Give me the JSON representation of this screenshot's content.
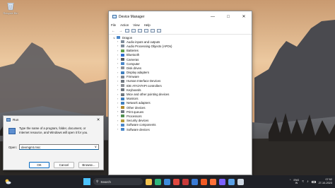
{
  "desktop": {
    "recycle_bin_label": "Recycle Bin"
  },
  "device_manager": {
    "title": "Device Manager",
    "menu": [
      "File",
      "Action",
      "View",
      "Help"
    ],
    "root": "Dragon",
    "categories": [
      {
        "label": "Audio inputs and outputs",
        "color": "#7f8c9a"
      },
      {
        "label": "Audio Processing Objects (APOs)",
        "color": "#7f8c9a"
      },
      {
        "label": "Batteries",
        "color": "#5f9e4a"
      },
      {
        "label": "Bluetooth",
        "color": "#2f6fd0"
      },
      {
        "label": "Cameras",
        "color": "#555b63"
      },
      {
        "label": "Computer",
        "color": "#4a87c9"
      },
      {
        "label": "Disk drives",
        "color": "#8a8f96"
      },
      {
        "label": "Display adapters",
        "color": "#3f7fbf"
      },
      {
        "label": "Firmware",
        "color": "#7d8590"
      },
      {
        "label": "Human Interface Devices",
        "color": "#6f7780"
      },
      {
        "label": "IDE ATA/ATAPI controllers",
        "color": "#8a8f96"
      },
      {
        "label": "Keyboards",
        "color": "#6f7780"
      },
      {
        "label": "Mice and other pointing devices",
        "color": "#6f7780"
      },
      {
        "label": "Monitors",
        "color": "#3f7fbf"
      },
      {
        "label": "Network adapters",
        "color": "#3f7fbf"
      },
      {
        "label": "Other devices",
        "color": "#b08a2e"
      },
      {
        "label": "Print queues",
        "color": "#6f7780"
      },
      {
        "label": "Processors",
        "color": "#4f8f4f"
      },
      {
        "label": "Security devices",
        "color": "#b59a3a"
      },
      {
        "label": "Software components",
        "color": "#4a87c9"
      },
      {
        "label": "Software devices",
        "color": "#4a87c9"
      }
    ]
  },
  "run_dialog": {
    "title": "Run",
    "description": "Type the name of a program, folder, document, or Internet resource, and Windows will open it for you.",
    "open_label": "Open:",
    "open_value": "devmgmt.msc",
    "ok_label": "OK",
    "cancel_label": "Cancel",
    "browse_label": "Browse..."
  },
  "taskbar": {
    "search_placeholder": "Search",
    "apps": [
      {
        "name": "file-explorer",
        "color": "#f2c14e"
      },
      {
        "name": "edge",
        "color": "#2fb67c"
      },
      {
        "name": "browser",
        "color": "#3d8bdb"
      },
      {
        "name": "chrome",
        "color": "#e0483f"
      },
      {
        "name": "app",
        "color": "#c93a3a"
      },
      {
        "name": "mail",
        "color": "#3a7bd5"
      },
      {
        "name": "brave",
        "color": "#f25a24"
      },
      {
        "name": "firefox",
        "color": "#ff7139"
      },
      {
        "name": "app",
        "color": "#7b61ff"
      },
      {
        "name": "store",
        "color": "#5aa0e6"
      },
      {
        "name": "device-manager",
        "color": "#cfd8e3"
      }
    ],
    "language": [
      "ENG",
      "IN"
    ],
    "time": "07:52",
    "date": "27-10-2023"
  }
}
